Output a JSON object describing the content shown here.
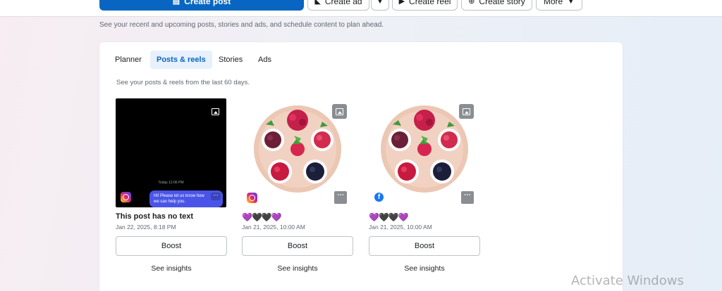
{
  "toolbar": {
    "create_post": "Create post",
    "create_ad": "Create ad",
    "create_reel": "Create reel",
    "create_story": "Create story",
    "more": "More"
  },
  "subtitle": "See your recent and upcoming posts, stories and ads, and schedule content to plan ahead.",
  "tabs": [
    {
      "label": "Planner",
      "active": false
    },
    {
      "label": "Posts & reels",
      "active": true
    },
    {
      "label": "Stories",
      "active": false
    },
    {
      "label": "Ads",
      "active": false
    }
  ],
  "hint": "See your posts & reels from the last 60 days.",
  "posts": [
    {
      "title": "This post has no text",
      "date": "Jan 22, 2025, 8:18 PM",
      "platform": "instagram",
      "thumb_clock": "Today 12:06 PM",
      "thumb_bubble": "Hi! Please let us know how we can help you.",
      "boost": "Boost",
      "insights": "See insights"
    },
    {
      "emoji": "💜🖤🖤💜",
      "date": "Jan 21, 2025, 10:00 AM",
      "platform": "instagram",
      "boost": "Boost",
      "insights": "See insights"
    },
    {
      "emoji": "💜🖤🖤💜",
      "date": "Jan 21, 2025, 10:00 AM",
      "platform": "facebook",
      "boost": "Boost",
      "insights": "See insights"
    }
  ],
  "watermark": "Activate Windows",
  "colors": {
    "primary": "#0866c2",
    "tab_active_bg": "#e7f0fb"
  }
}
